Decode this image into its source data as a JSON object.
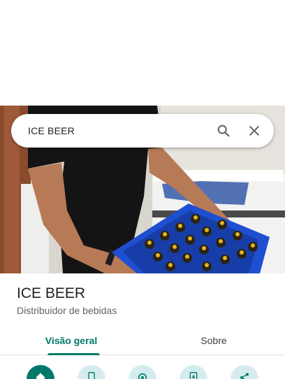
{
  "search": {
    "query": "ICE BEER"
  },
  "place": {
    "name": "ICE BEER",
    "category": "Distribuidor de bebidas"
  },
  "tabs": [
    {
      "label": "Visão geral",
      "selected": true
    },
    {
      "label": "Sobre",
      "selected": false
    }
  ],
  "actions": [
    {
      "icon": "directions-icon",
      "primary": true
    },
    {
      "icon": "phone-icon",
      "primary": false
    },
    {
      "icon": "save-icon",
      "primary": false
    },
    {
      "icon": "send-to-phone-icon",
      "primary": false
    },
    {
      "icon": "share-icon",
      "primary": false
    }
  ],
  "colors": {
    "accent": "#00796b",
    "action_bg": "#d4ecee"
  }
}
